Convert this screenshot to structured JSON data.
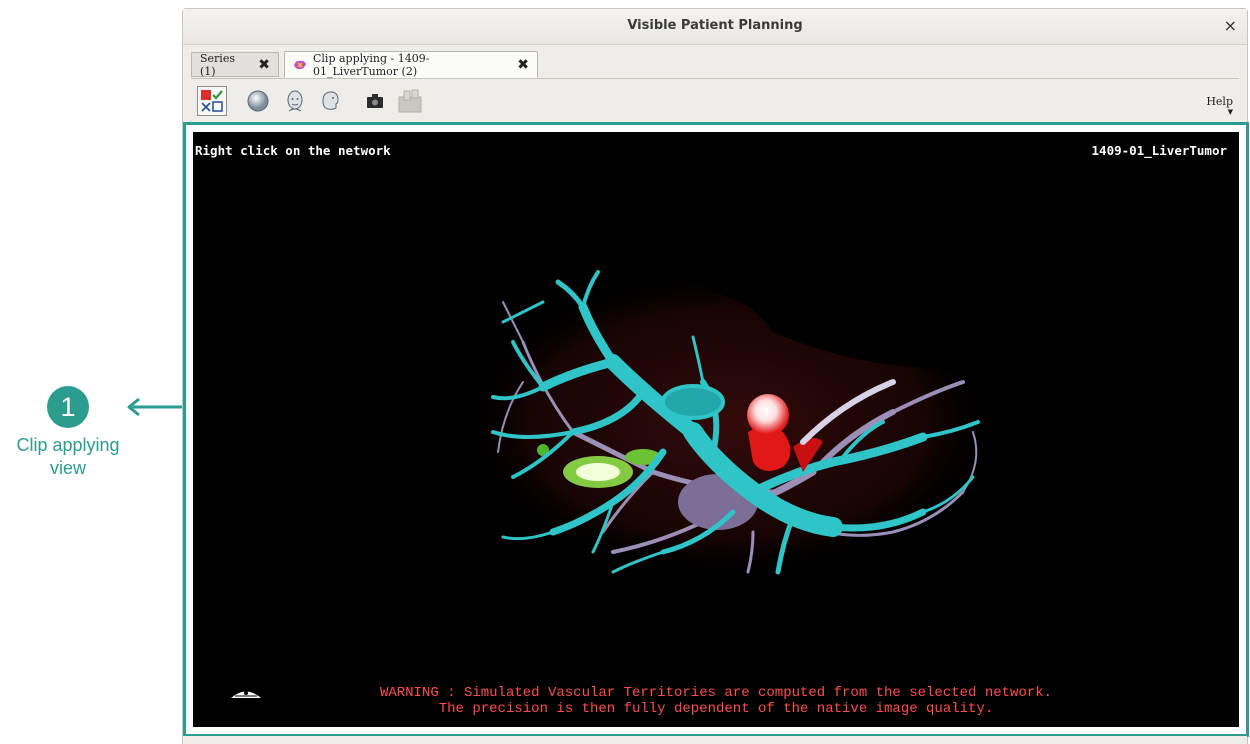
{
  "annotation": {
    "number": "1",
    "caption_line1": "Clip applying",
    "caption_line2": "view"
  },
  "window": {
    "title": "Visible Patient Planning",
    "close_glyph": "×"
  },
  "tabs": [
    {
      "label": "Series (1)",
      "close_glyph": "✖",
      "active": false
    },
    {
      "label": "Clip applying - 1409-01_LiverTumor (2)",
      "close_glyph": "✖",
      "active": true,
      "icon": "clip-applying-icon"
    }
  ],
  "toolbar": {
    "buttons": [
      {
        "name": "clip-selection-icon",
        "selected": true
      },
      {
        "name": "sphere-view-icon",
        "selected": false
      },
      {
        "name": "head-front-view-icon",
        "selected": false
      },
      {
        "name": "head-side-view-icon",
        "selected": false
      },
      {
        "name": "camera-snapshot-icon",
        "selected": false
      },
      {
        "name": "export-icon",
        "selected": false,
        "disabled": true
      }
    ],
    "help_label": "Help"
  },
  "viewport": {
    "instruction": "Right click on the network",
    "series_name": "1409-01_LiverTumor",
    "warning_line1": "WARNING : Simulated Vascular Territories are computed from the selected network.",
    "warning_line2": "The precision is then fully dependent of the native image quality.",
    "orientation_marker": "orientation-icon"
  },
  "colors": {
    "accent": "#2a9d8f",
    "vessels_portal": "#2fc4c8",
    "vessels_hepatic": "#9b8fb8",
    "tumor": "#ff3030",
    "warning": "#ff4c4c"
  }
}
